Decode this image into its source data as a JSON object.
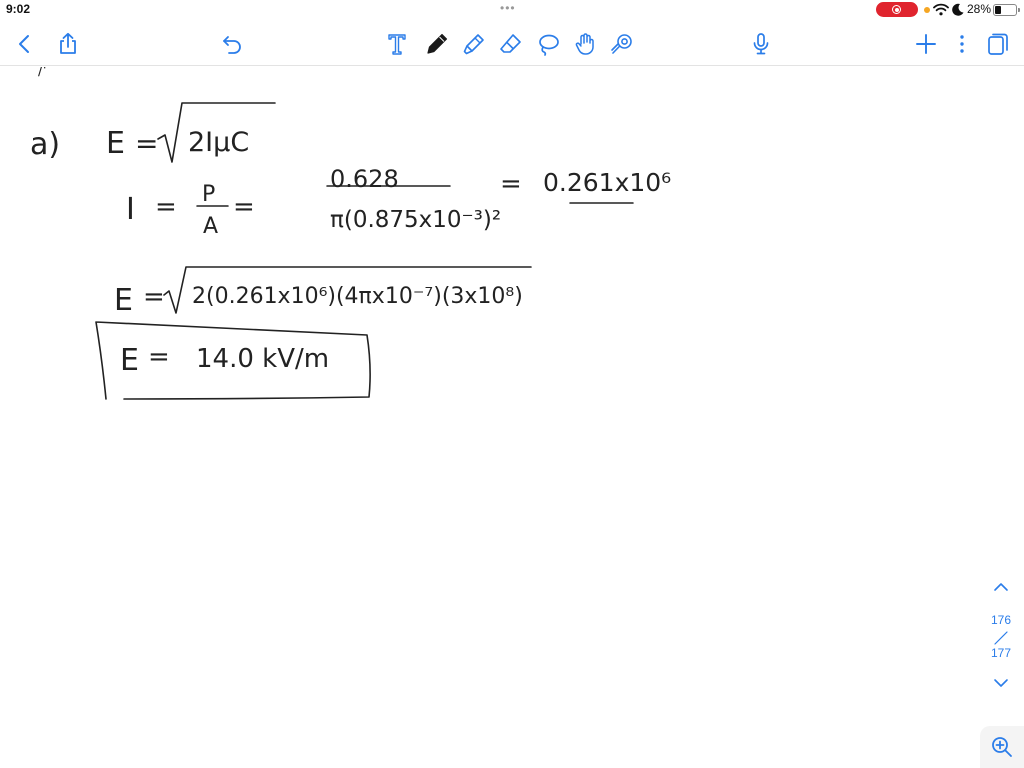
{
  "status_bar": {
    "time": "9:02",
    "dots": "•••",
    "battery_percent": "28%",
    "battery_level": 0.28,
    "record_indicator_color": "#e0242e",
    "privacy_dot_color": "#f5a623"
  },
  "toolbar": {
    "accent_color": "#2b7de9",
    "left_icons": [
      "back-chevron-icon",
      "share-icon",
      "undo-icon"
    ],
    "tools": [
      "text-tool-icon",
      "pen-icon",
      "highlighter-icon",
      "eraser-icon",
      "lasso-icon",
      "hand-select-icon",
      "laser-pointer-icon"
    ],
    "right_icons": [
      "microphone-icon",
      "add-icon",
      "more-icon",
      "pages-icon"
    ]
  },
  "note": {
    "fragment": "/'",
    "part_label": "a)",
    "line1": {
      "lhs": "E",
      "op": "=",
      "radicand": "2IμC"
    },
    "line2": {
      "lhs": "I",
      "op1": "=",
      "numerator": "P",
      "denominator": "A",
      "op2": "=",
      "numerator2": "0.628",
      "denominator2": "π(0.875x10⁻³)²",
      "op3": "=",
      "result": "0.261x10⁶"
    },
    "line3": {
      "lhs": "E",
      "op": "=",
      "radicand": "2(0.261x10⁶)(4πx10⁻⁷)(3x10⁸)"
    },
    "answer": {
      "lhs": "E",
      "op": "=",
      "value": "14.0 kV/m"
    }
  },
  "page_nav": {
    "current": "176",
    "total": "177"
  }
}
